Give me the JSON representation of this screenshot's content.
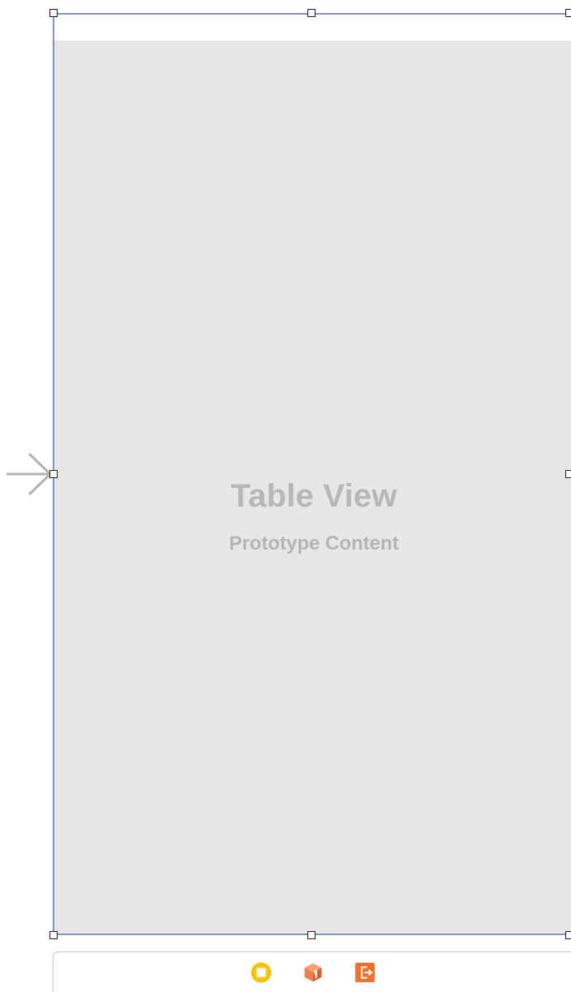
{
  "storyboard": {
    "scene": {
      "table_view": {
        "title": "Table View",
        "subtitle": "Prototype Content"
      }
    },
    "dock": {
      "items": [
        {
          "icon": "view-controller-icon",
          "color": "#f5c518"
        },
        {
          "icon": "first-responder-icon",
          "color": "#ef7e4a"
        },
        {
          "icon": "exit-icon",
          "color": "#f06e2d"
        }
      ]
    }
  }
}
